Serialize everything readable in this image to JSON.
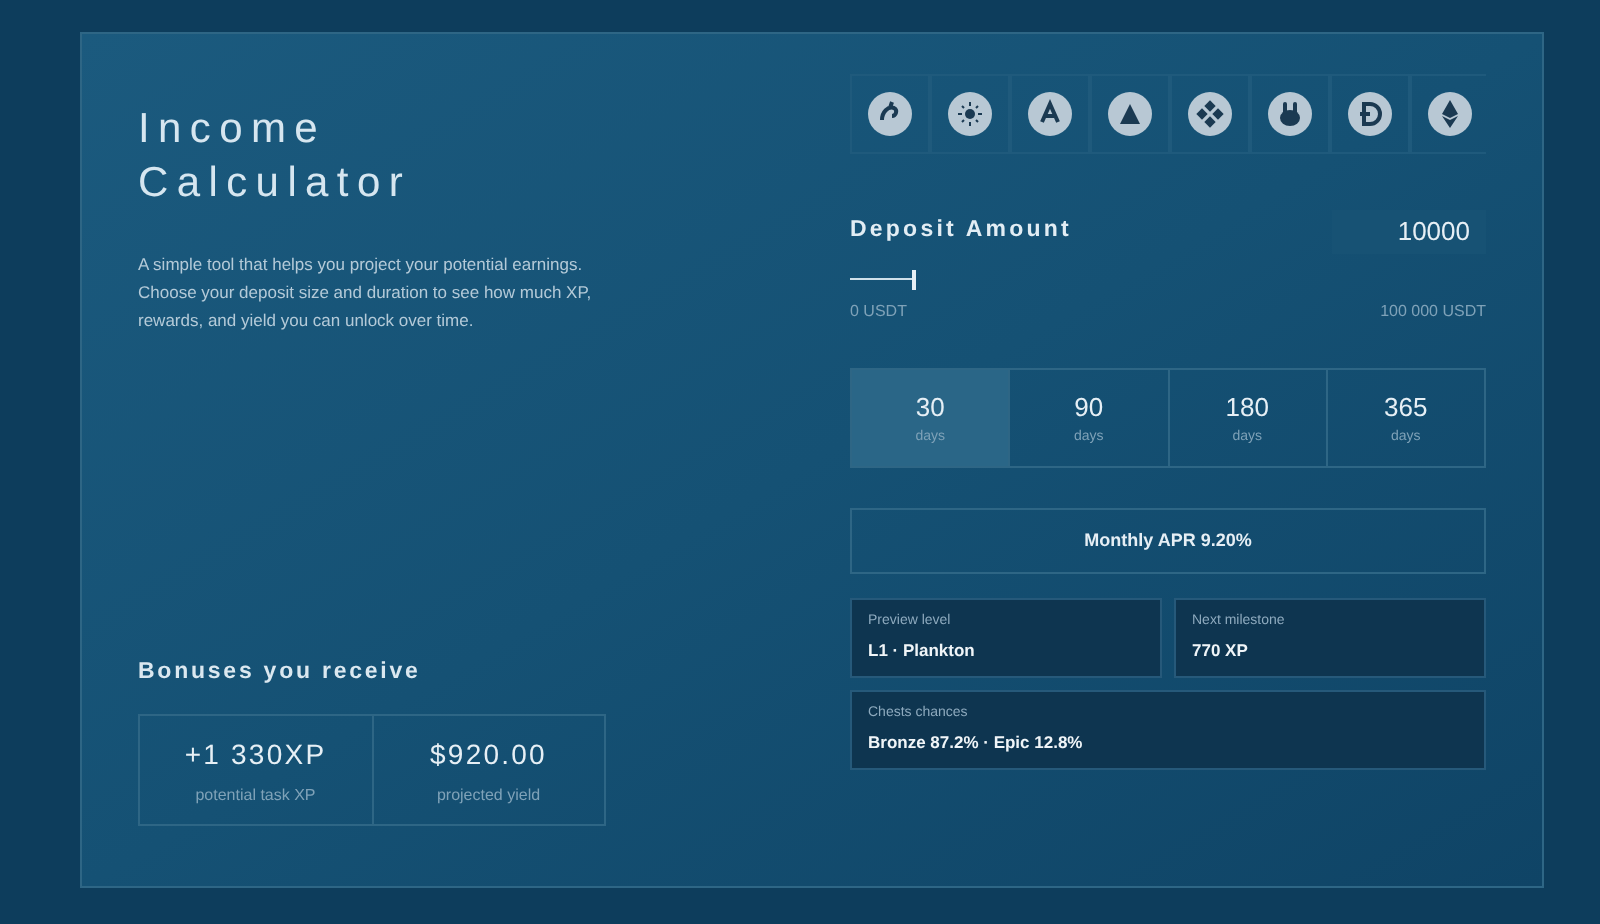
{
  "title": [
    "Income",
    "Calculator"
  ],
  "description": "A simple tool that helps you project your potential earnings. Choose your deposit size and duration to see how much XP, rewards, and yield you can unlock over time.",
  "bonuses": {
    "heading": "Bonuses you receive",
    "items": [
      {
        "value": "+1 330XP",
        "label": "potential task XP"
      },
      {
        "value": "$920.00",
        "label": "projected yield"
      }
    ]
  },
  "deposit": {
    "label": "Deposit Amount",
    "value": "10000",
    "level": 0.1,
    "min_label": "0 USDT",
    "max_label": "100 000 USDT"
  },
  "durations": [
    {
      "value": "30",
      "unit": "days",
      "selected": true
    },
    {
      "value": "90",
      "unit": "days",
      "selected": false
    },
    {
      "value": "180",
      "unit": "days",
      "selected": false
    },
    {
      "value": "365",
      "unit": "days",
      "selected": false
    }
  ],
  "apr": "Monthly APR 9.20%",
  "stats": [
    {
      "label": "Preview level",
      "value": "L1 · Plankton"
    },
    {
      "label": "Next milestone",
      "value": "770 XP"
    },
    {
      "label": "Chests chances",
      "value": "Bronze 87.2% · Epic 12.8%"
    }
  ]
}
